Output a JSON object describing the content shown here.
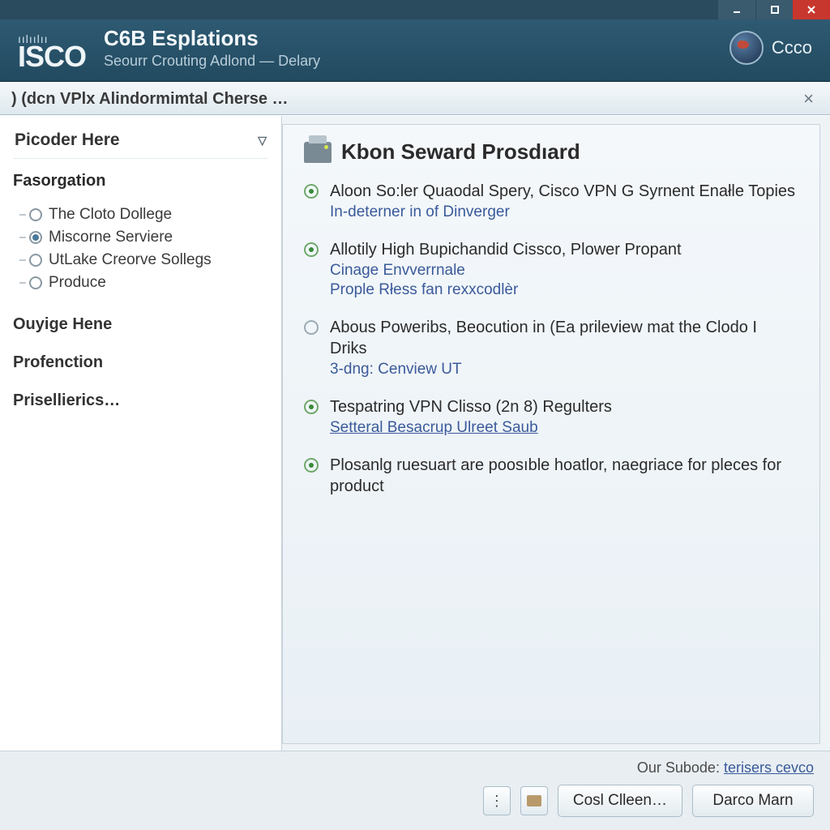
{
  "titlebar": {
    "minimize": "—",
    "maximize": "□",
    "close": "×"
  },
  "header": {
    "logo_tag": "ıılıılıı",
    "logo_text": "ISCO",
    "title": "C6B Esplations",
    "subtitle": "Seourr Crouting Adlond — Delary",
    "brand": "Ccco"
  },
  "tabbar": {
    "label": ") (dcn VPlx Alindormimtal Cherse …",
    "close": "×"
  },
  "sidebar": {
    "picoder": "Picoder Here",
    "section1": "Fasorgation",
    "items": [
      {
        "label": "The Cloto Dollege",
        "selected": false
      },
      {
        "label": "Miscorne Serviere",
        "selected": true
      },
      {
        "label": "UtLake Creorve Sollegs",
        "selected": false
      },
      {
        "label": "Produce",
        "selected": false
      }
    ],
    "links": [
      "Ouyige Hene",
      "Profenction",
      "Prisellierics…"
    ]
  },
  "content": {
    "heading": "Kbon Seward Prosdıard",
    "records": [
      {
        "checked": true,
        "title": "Aloon So:ler Quaodal Spery, Cisco VPN G Syrnent Enałle Topies",
        "subs": [
          "In-deterner in of Dinverger"
        ]
      },
      {
        "checked": true,
        "title": "Allotily High Bupichandid Cissco, Plower Propant",
        "subs": [
          "Cinage Envverrnale",
          "Prople Rłess fan rexxcodlèr"
        ]
      },
      {
        "checked": false,
        "title": "Abous Poweribs, Beocution in (Ea prileview mat the Clodo I Driks",
        "subs": [
          "3-dng: Cenview UT"
        ]
      },
      {
        "checked": true,
        "title": "Tespatring VPN Clisso (2n 8) Regulters",
        "subs_link": "Setteral Besacrup Ulreet Saub"
      },
      {
        "checked": true,
        "title": "Plosanlg ruesuart are poosıble hoatlor, naegriace for pleces for product"
      }
    ]
  },
  "footer": {
    "note_label": "Our Subode: ",
    "note_link": "terisers cevco",
    "menu": "⋮",
    "btn1": "Cosl Clleen…",
    "btn2": "Darco Marn"
  }
}
